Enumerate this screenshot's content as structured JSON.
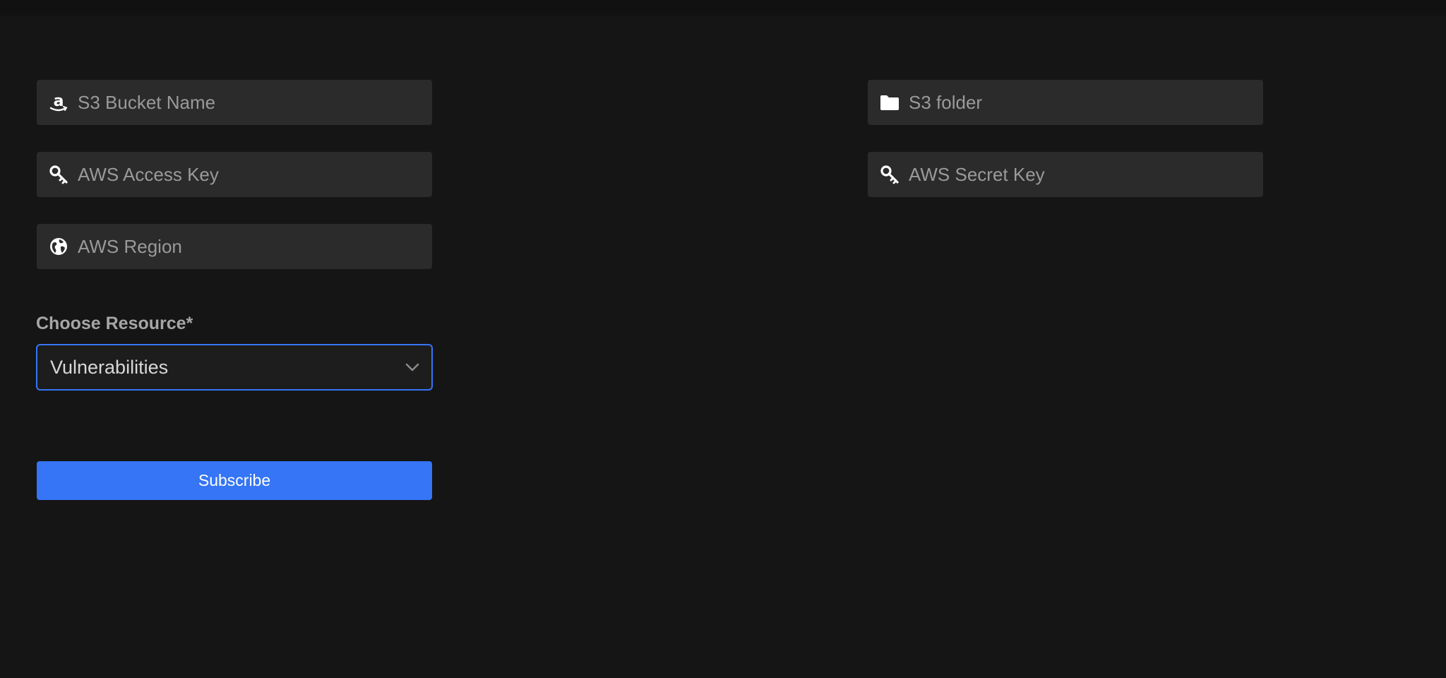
{
  "form": {
    "s3_bucket_name": {
      "placeholder": "S3 Bucket Name",
      "icon": "amazon-icon",
      "value": ""
    },
    "aws_access_key": {
      "placeholder": "AWS Access Key",
      "icon": "key-icon",
      "value": ""
    },
    "aws_region": {
      "placeholder": "AWS Region",
      "icon": "globe-icon",
      "value": ""
    },
    "s3_folder": {
      "placeholder": "S3 folder",
      "icon": "folder-icon",
      "value": ""
    },
    "aws_secret_key": {
      "placeholder": "AWS Secret Key",
      "icon": "key-icon",
      "value": ""
    },
    "resource": {
      "label": "Choose Resource*",
      "selected": "Vulnerabilities"
    },
    "subscribe_label": "Subscribe"
  },
  "colors": {
    "background": "#151515",
    "field_background": "#2b2b2b",
    "accent": "#3575f6",
    "placeholder": "#9a9a9a"
  }
}
